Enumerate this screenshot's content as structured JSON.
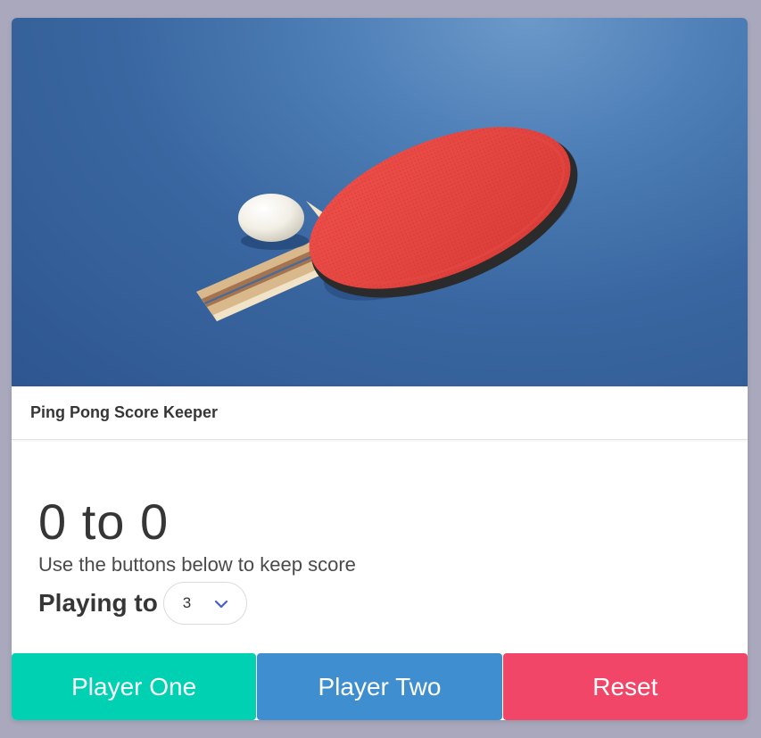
{
  "app": {
    "title": "Ping Pong Score Keeper",
    "hero_image": "ping-pong-paddle-and-ball"
  },
  "score": {
    "player_one": 0,
    "player_two": 0,
    "display": "0 to 0",
    "subtitle": "Use the buttons below to keep score"
  },
  "playing_to": {
    "label": "Playing to",
    "selected": "3"
  },
  "buttons": {
    "player_one": "Player One",
    "player_two": "Player Two",
    "reset": "Reset"
  },
  "colors": {
    "player_one": "#00d1b2",
    "player_two": "#3e8ed0",
    "reset": "#f14668",
    "chevron": "#485fc7",
    "page_background": "#aaa8bc"
  }
}
